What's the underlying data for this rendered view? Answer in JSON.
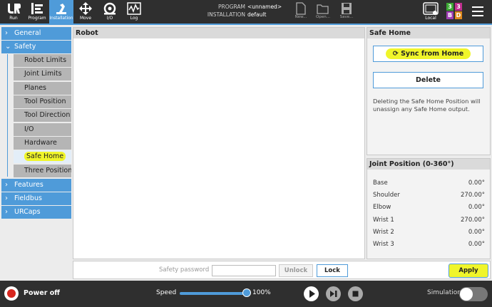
{
  "topbar": {
    "tabs": [
      {
        "label": "Run",
        "icon": "ur-logo-icon"
      },
      {
        "label": "Program",
        "icon": "program-icon"
      },
      {
        "label": "Installation",
        "icon": "installation-icon"
      },
      {
        "label": "Move",
        "icon": "move-icon"
      },
      {
        "label": "I/O",
        "icon": "io-icon"
      },
      {
        "label": "Log",
        "icon": "log-icon"
      }
    ],
    "program_label": "PROGRAM",
    "program_value": "<unnamed>",
    "installation_label": "INSTALLATION",
    "installation_value": "default",
    "new_label": "New...",
    "open_label": "Open...",
    "save_label": "Save...",
    "local_label": "Local",
    "badges": [
      "3",
      "3",
      "B",
      "D"
    ],
    "badge_colors": [
      "#3da935",
      "#c0308f",
      "#a03fb5",
      "#e08a1e"
    ]
  },
  "nav": {
    "general": "General",
    "safety": "Safety",
    "safety_items": [
      "Robot Limits",
      "Joint Limits",
      "Planes",
      "Tool Position",
      "Tool Direction",
      "I/O",
      "Hardware",
      "Safe Home",
      "Three Position"
    ],
    "features": "Features",
    "fieldbus": "Fieldbus",
    "urcaps": "URCaps"
  },
  "robot_panel": {
    "title": "Robot"
  },
  "safe_home": {
    "title": "Safe Home",
    "sync_label": "Sync from Home",
    "delete_label": "Delete",
    "description": "Deleting the Safe Home Position will unassign any Safe Home output."
  },
  "joint_position": {
    "title": "Joint Position (0-360°)",
    "joints": [
      {
        "name": "Base",
        "value": "0.00°"
      },
      {
        "name": "Shoulder",
        "value": "270.00°"
      },
      {
        "name": "Elbow",
        "value": "0.00°"
      },
      {
        "name": "Wrist 1",
        "value": "270.00°"
      },
      {
        "name": "Wrist 2",
        "value": "0.00°"
      },
      {
        "name": "Wrist 3",
        "value": "0.00°"
      }
    ]
  },
  "actions": {
    "password_label": "Safety password",
    "password_value": "",
    "unlock_label": "Unlock",
    "lock_label": "Lock",
    "apply_label": "Apply"
  },
  "footer": {
    "power_label": "Power off",
    "speed_label": "Speed",
    "speed_value": "100%",
    "speed_fraction": 1.0,
    "simulation_label": "Simulation",
    "simulation_on": false
  },
  "colors": {
    "accent": "#4f9bd9",
    "highlight": "#f0f52a",
    "power": "#d7261e"
  }
}
